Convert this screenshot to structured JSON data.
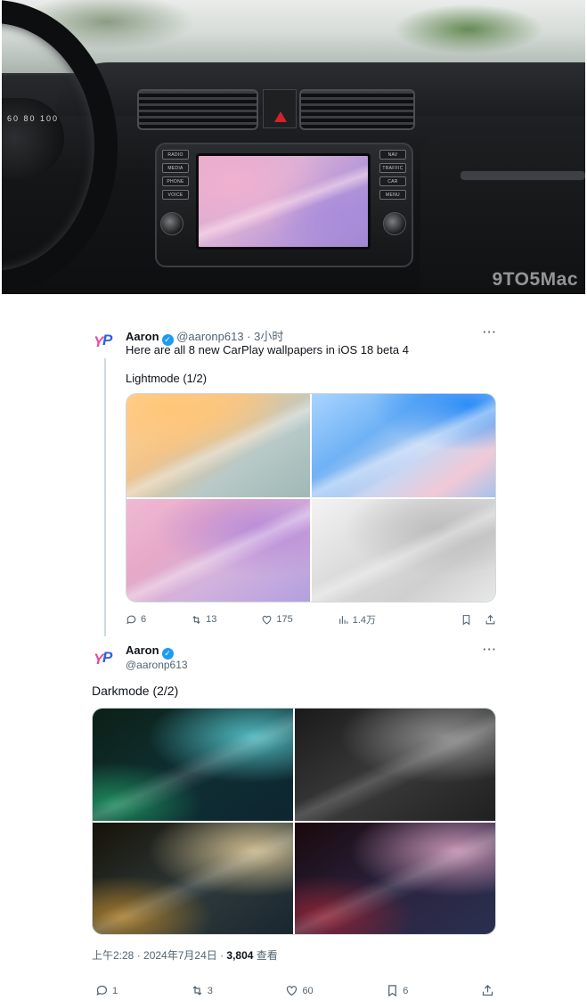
{
  "photo": {
    "watermark": "9TO5Mac",
    "gauge_numbers": "60 80 100",
    "head_unit_buttons_left": [
      "RADIO",
      "MEDIA",
      "PHONE",
      "VOICE"
    ],
    "head_unit_buttons_right": [
      "NAV",
      "TRAFFIC",
      "CAR",
      "MENU"
    ]
  },
  "tweet1": {
    "avatar_text_1": "Y",
    "avatar_text_2": "P",
    "name": "Aaron",
    "handle_time": "@aaronp613 · 3小时",
    "text": "Here are all 8 new CarPlay wallpapers in iOS 18 beta 4",
    "subtitle": "Lightmode (1/2)",
    "more": "···",
    "actions": {
      "replies": "6",
      "retweets": "13",
      "likes": "175",
      "views": "1.4万"
    }
  },
  "tweet2": {
    "avatar_text_1": "Y",
    "avatar_text_2": "P",
    "name": "Aaron",
    "handle": "@aaronp613",
    "text": "Darkmode (2/2)",
    "more": "···",
    "meta_time": "上午2:28 · 2024年7月24日 · ",
    "views_count": "3,804",
    "views_label": " 查看",
    "actions": {
      "replies": "1",
      "retweets": "3",
      "likes": "60",
      "bookmarks": "6"
    }
  },
  "colors": {
    "verified": "#1d9bf0",
    "muted": "#536471",
    "text": "#0f1419"
  }
}
